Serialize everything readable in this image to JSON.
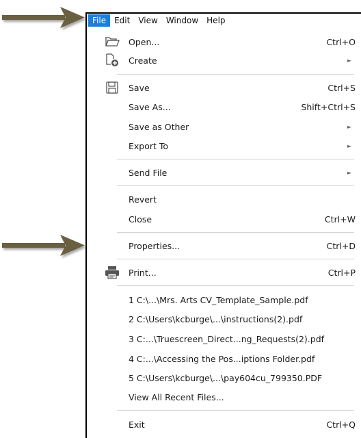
{
  "menubar": {
    "items": [
      "File",
      "Edit",
      "View",
      "Window",
      "Help"
    ]
  },
  "menu": {
    "open": {
      "label": "Open...",
      "shortcut": "Ctrl+O"
    },
    "create": {
      "label": "Create"
    },
    "save": {
      "label": "Save",
      "shortcut": "Ctrl+S"
    },
    "save_as": {
      "label": "Save As...",
      "shortcut": "Shift+Ctrl+S"
    },
    "save_other": {
      "label": "Save as Other"
    },
    "export_to": {
      "label": "Export To"
    },
    "send_file": {
      "label": "Send File"
    },
    "revert": {
      "label": "Revert"
    },
    "close": {
      "label": "Close",
      "shortcut": "Ctrl+W"
    },
    "properties": {
      "label": "Properties...",
      "shortcut": "Ctrl+D"
    },
    "print": {
      "label": "Print...",
      "shortcut": "Ctrl+P"
    },
    "recent": [
      "1 C:\\...\\Mrs. Arts CV_Template_Sample.pdf",
      "2 C:\\Users\\kcburge\\...\\instructions(2).pdf",
      "3 C:...\\Truescreen_Direct...ng_Requests(2).pdf",
      "4 C:...\\Accessing the Pos...iptions Folder.pdf",
      "5 C:\\Users\\kcburge\\...\\pay604cu_799350.PDF"
    ],
    "view_all_recent": {
      "label": "View All Recent Files..."
    },
    "exit": {
      "label": "Exit",
      "shortcut": "Ctrl+Q"
    }
  },
  "colors": {
    "accent": "#1a7de0",
    "arrow": "#6b5f3f"
  }
}
